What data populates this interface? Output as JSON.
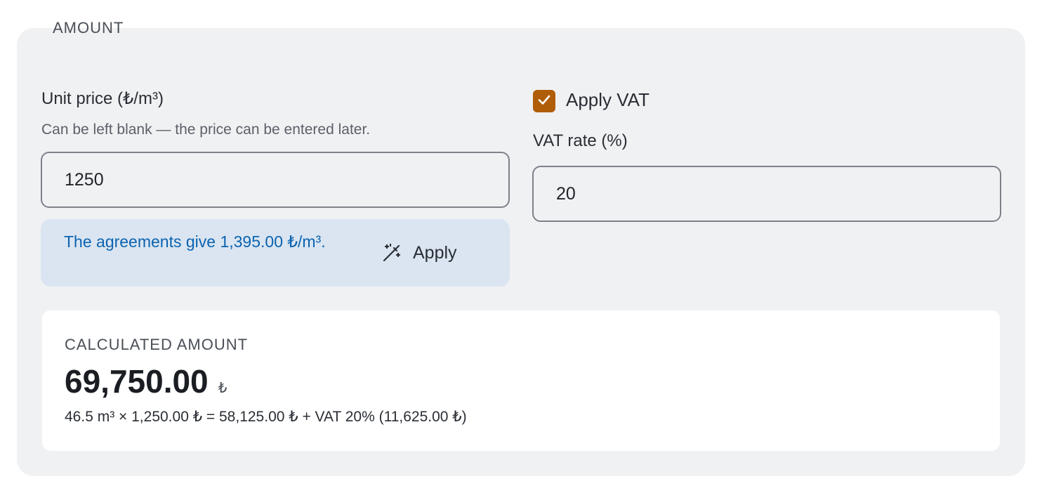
{
  "section": {
    "legend": "AMOUNT"
  },
  "unit_price": {
    "label": "Unit price (₺/m³)",
    "hint": "Can be left blank — the price can be entered later.",
    "value": "1250"
  },
  "suggestion": {
    "text": "The agreements give 1,395.00 ₺/m³.",
    "apply_label": "Apply",
    "icon": "magic-wand-icon"
  },
  "vat": {
    "checkbox_label": "Apply VAT",
    "checked": true,
    "rate_label": "VAT rate (%)",
    "rate_value": "20"
  },
  "result": {
    "title": "CALCULATED AMOUNT",
    "amount": "69,750.00",
    "currency": "₺",
    "breakdown": "46.5 m³ × 1,250.00 ₺ = 58,125.00 ₺ + VAT 20% (11,625.00 ₺)"
  },
  "colors": {
    "panel_bg": "#f0f1f3",
    "accent_checkbox": "#b05d09",
    "suggestion_bg": "#dae5f1",
    "suggestion_text": "#0c63b0"
  }
}
